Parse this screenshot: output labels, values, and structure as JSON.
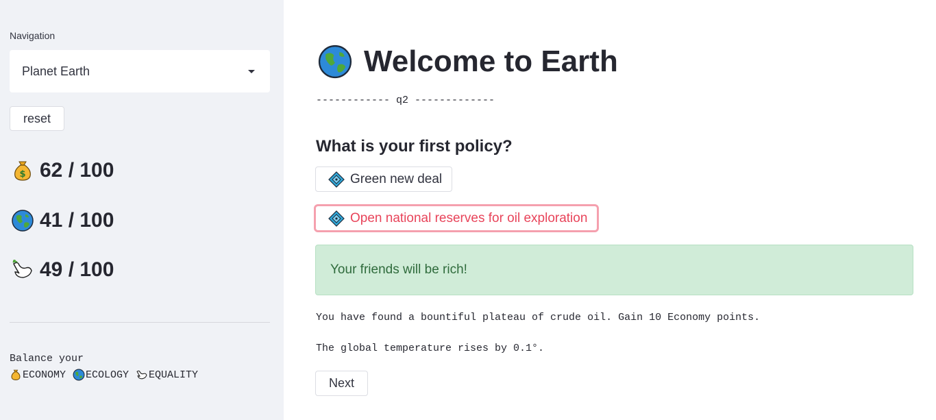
{
  "sidebar": {
    "nav_label": "Navigation",
    "select_value": "Planet Earth",
    "reset_label": "reset",
    "stats": {
      "economy": "62 / 100",
      "ecology": "41 / 100",
      "equality": "49 / 100"
    },
    "balance_text": "Balance your",
    "balance_items": {
      "economy": "ECONOMY",
      "ecology": "ECOLOGY",
      "equality": "EQUALITY"
    }
  },
  "main": {
    "title": "Welcome to Earth",
    "question_separator": "------------ q2 -------------",
    "question": "What is your first policy?",
    "options": [
      {
        "label": "Green new deal"
      },
      {
        "label": "Open national reserves for oil exploration"
      }
    ],
    "alert_text": "Your friends will be rich!",
    "result_line_1": "You have found a bountiful plateau of crude oil. Gain 10 Economy points.",
    "result_line_2": "The global temperature rises by 0.1°.",
    "next_label": "Next"
  },
  "colors": {
    "sidebar_bg": "#f0f2f6",
    "selected_option_border": "#f5a0ae",
    "selected_option_text": "#e8445a",
    "success_bg": "#d0ecd8",
    "success_text": "#2f6b3c"
  },
  "icons": {
    "economy": "money-bag-icon",
    "ecology": "globe-icon",
    "equality": "dove-icon",
    "option": "diamond-icon",
    "select": "chevron-down-icon"
  }
}
